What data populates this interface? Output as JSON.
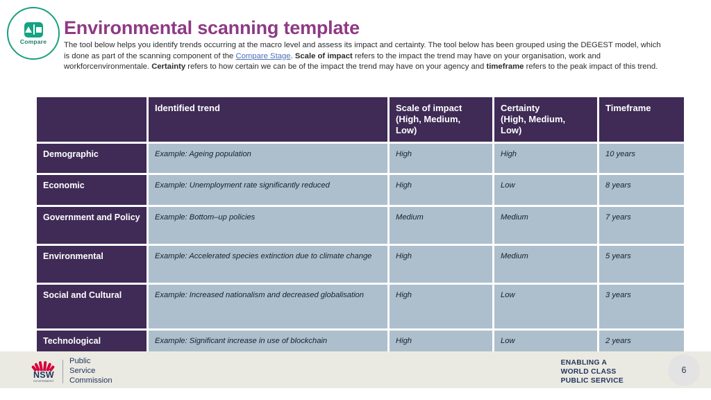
{
  "logo": {
    "label": "Compare",
    "icon": "compare-balance-icon",
    "accent_color": "#14a383"
  },
  "header": {
    "title": "Environmental scanning template",
    "title_color": "#8e3a84",
    "description_parts": [
      {
        "text": "The tool below helps you identify trends occurring at the macro level and assess its impact and certainty. The tool below has been grouped using the DEGEST model, which is done as part of the scanning component of the ",
        "style": "normal"
      },
      {
        "text": "Compare Stage",
        "style": "link"
      },
      {
        "text": ". ",
        "style": "normal"
      },
      {
        "text": "Scale of impact",
        "style": "bold"
      },
      {
        "text": " refers to the impact the trend may have on your organisation, work and workforcenvironmentale. ",
        "style": "normal"
      },
      {
        "text": "Certainty",
        "style": "bold"
      },
      {
        "text": " refers to how certain we can be of the impact the trend may have on your agency and ",
        "style": "normal"
      },
      {
        "text": "timeframe",
        "style": "bold"
      },
      {
        "text": " refers to the peak impact of this trend.",
        "style": "normal"
      }
    ]
  },
  "table": {
    "header_bg": "#3f2b56",
    "cell_bg": "#adbfcc",
    "headers": {
      "category": "",
      "trend": "Identified trend",
      "scale": "Scale of impact (High, Medium, Low)",
      "certainty": "Certainty (High, Medium, Low)",
      "timeframe": "Timeframe"
    },
    "header_lines": {
      "scale": [
        "Scale of impact",
        "(High, Medium,",
        "Low)"
      ],
      "certainty": [
        "Certainty",
        "(High, Medium,",
        "Low)"
      ]
    },
    "rows": [
      {
        "category": "Demographic",
        "trend": "Example: Ageing population",
        "scale": "High",
        "certainty": "High",
        "timeframe": "10 years"
      },
      {
        "category": "Economic",
        "trend": "Example: Unemployment rate significantly reduced",
        "scale": "High",
        "certainty": "Low",
        "timeframe": "8 years"
      },
      {
        "category": "Government and Policy",
        "trend": "Example: Bottom–up policies",
        "scale": "Medium",
        "certainty": "Medium",
        "timeframe": "7 years"
      },
      {
        "category": "Environmental",
        "trend": "Example: Accelerated species extinction due to climate change",
        "scale": "High",
        "certainty": "Medium",
        "timeframe": "5 years"
      },
      {
        "category": "Social and Cultural",
        "trend": "Example: Increased nationalism and decreased globalisation",
        "scale": "High",
        "certainty": "Low",
        "timeframe": "3 years"
      },
      {
        "category": "Technological",
        "trend": "Example: Significant increase in use of blockchain",
        "scale": "High",
        "certainty": "Low",
        "timeframe": "2 years"
      }
    ]
  },
  "footer": {
    "nsw_wordmark": "NSW",
    "nsw_subtext": "GOVERNMENT",
    "org_lines": [
      "Public",
      "Service",
      "Commission"
    ],
    "tagline_lines": [
      "ENABLING A",
      "WORLD CLASS",
      "PUBLIC SERVICE"
    ],
    "page_number": "6",
    "bg": "#ebeae2",
    "text_color": "#22355e"
  }
}
